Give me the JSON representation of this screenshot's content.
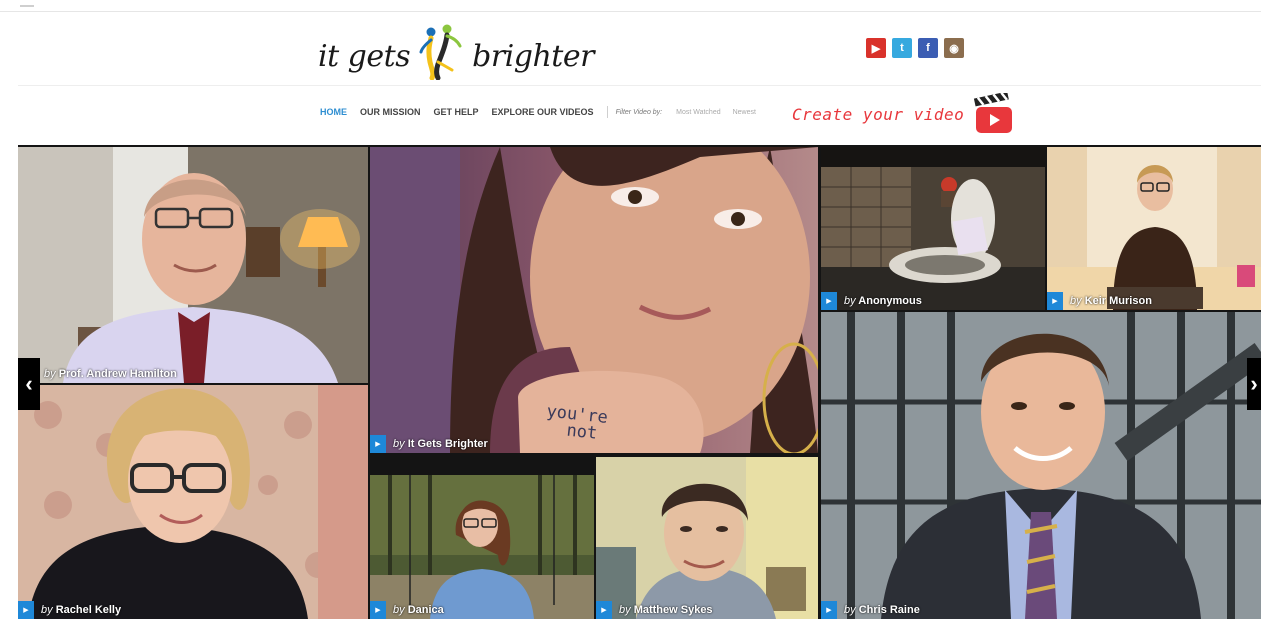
{
  "site": {
    "logo_left": "it gets",
    "logo_right": "brighter",
    "logo_icon": "two-figures-logo"
  },
  "social": [
    {
      "name": "youtube-icon",
      "glyph": "▶"
    },
    {
      "name": "twitter-icon",
      "glyph": "t"
    },
    {
      "name": "facebook-icon",
      "glyph": "f"
    },
    {
      "name": "instagram-icon",
      "glyph": "◉"
    }
  ],
  "nav": {
    "items": [
      "HOME",
      "OUR MISSION",
      "GET HELP",
      "EXPLORE OUR VIDEOS"
    ],
    "active": "HOME",
    "filter_label": "Filter Video by:",
    "filters": [
      "Most Watched",
      "Newest"
    ],
    "create_label": "Create your video",
    "create_icon": "clapperboard-play-icon"
  },
  "videos": [
    {
      "by": "by",
      "author": "Prof. Andrew Hamilton"
    },
    {
      "by": "by",
      "author": "It Gets Brighter"
    },
    {
      "by": "by",
      "author": "Anonymous"
    },
    {
      "by": "by",
      "author": "Keir Murison"
    },
    {
      "by": "by",
      "author": "Rachel Kelly"
    },
    {
      "by": "by",
      "author": "Danica"
    },
    {
      "by": "by",
      "author": "Matthew Sykes"
    },
    {
      "by": "by",
      "author": "Chris Raine"
    }
  ],
  "hand_text": "you're not alon",
  "arrows": {
    "prev": "‹",
    "next": "›"
  },
  "colors": {
    "accent": "#2e8ed1",
    "create": "#e8373c",
    "play": "#1e88d8"
  }
}
